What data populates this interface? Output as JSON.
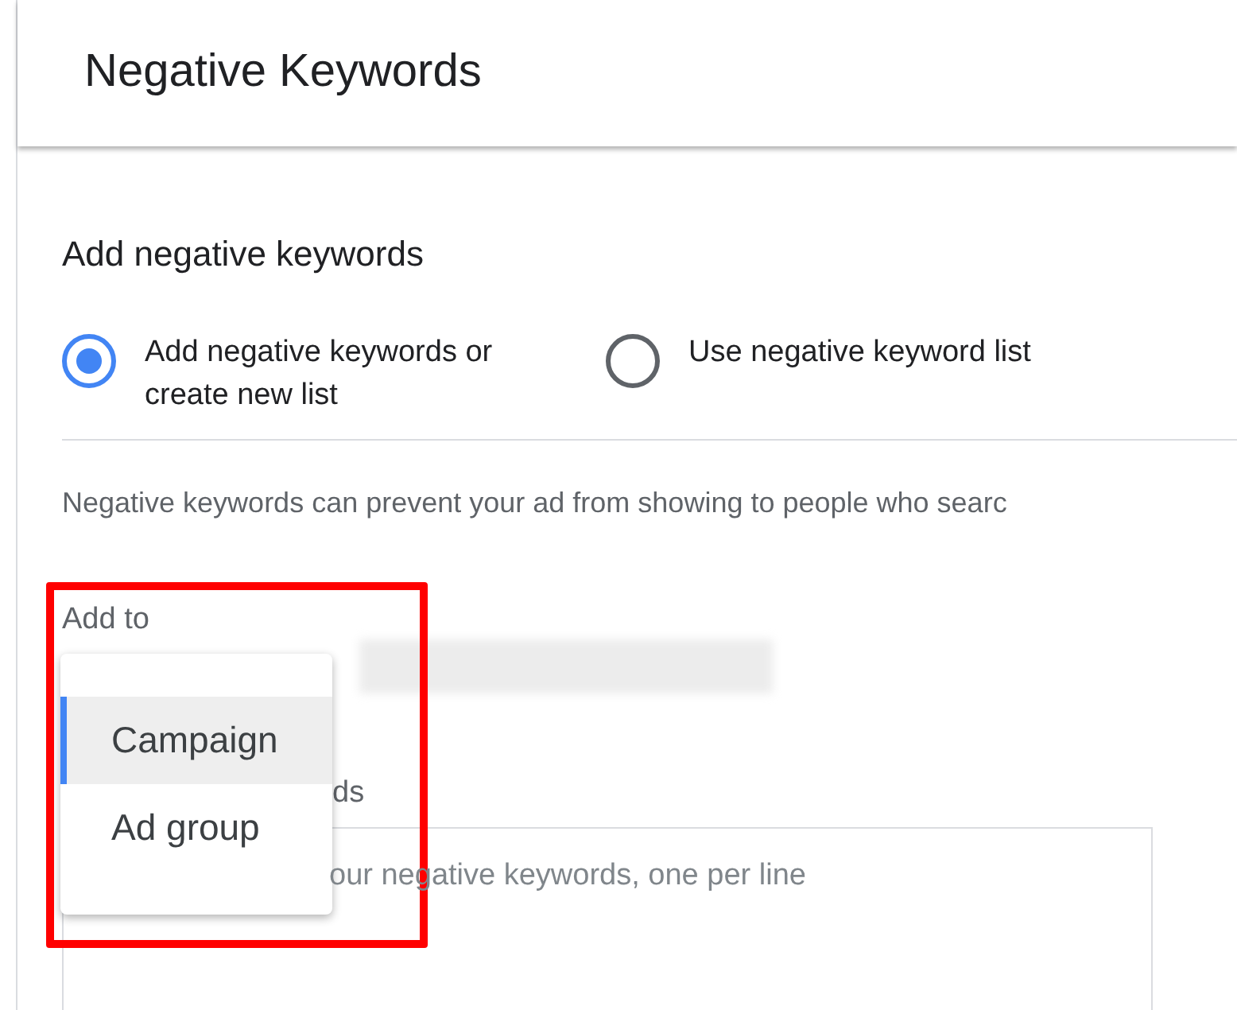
{
  "header": {
    "title": "Negative Keywords"
  },
  "section": {
    "title": "Add negative keywords"
  },
  "options": [
    {
      "label": "Add negative keywords or create new list",
      "selected": true
    },
    {
      "label": "Use negative keyword list",
      "selected": false
    }
  ],
  "description": "Negative keywords can prevent your ad from showing to people who searc",
  "add_to": {
    "label": "Add to",
    "menu": [
      {
        "label": "Campaign",
        "selected": true
      },
      {
        "label": "Ad group",
        "selected": false
      }
    ]
  },
  "keywords_label": "ds",
  "keywords_field": {
    "placeholder": "our negative keywords, one per line"
  }
}
